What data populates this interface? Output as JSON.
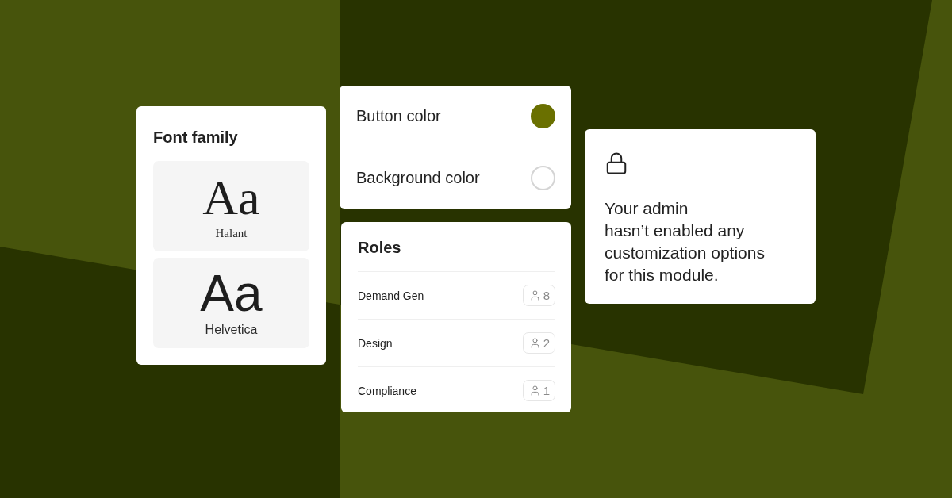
{
  "font_family": {
    "title": "Font family",
    "options": [
      {
        "sample": "Aa",
        "name": "Halant",
        "kind": "serif"
      },
      {
        "sample": "Aa",
        "name": "Helvetica",
        "kind": "sans"
      }
    ]
  },
  "color_settings": [
    {
      "label": "Button color",
      "color": "#6a7000"
    },
    {
      "label": "Background color",
      "color": "#ffffff"
    }
  ],
  "roles": {
    "title": "Roles",
    "items": [
      {
        "name": "Demand Gen",
        "count": "8"
      },
      {
        "name": "Design",
        "count": "2"
      },
      {
        "name": "Compliance",
        "count": "1"
      }
    ]
  },
  "locked_notice": {
    "message": "Your admin\nhasn’t enabled any\ncustomization options\nfor this module."
  }
}
